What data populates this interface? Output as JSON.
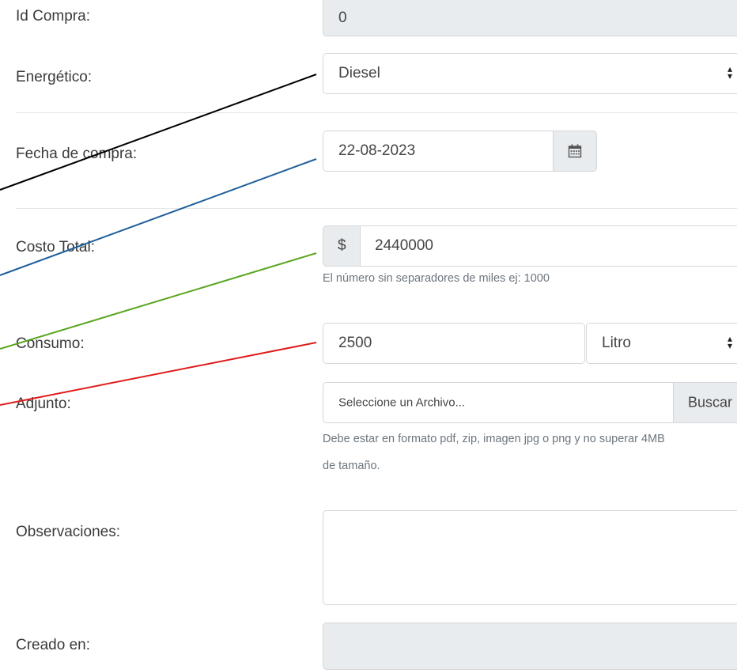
{
  "form": {
    "id_compra": {
      "label": "Id Compra:",
      "value": "0"
    },
    "energetico": {
      "label": "Energético:",
      "value": "Diesel"
    },
    "fecha": {
      "label": "Fecha de compra:",
      "value": "22-08-2023",
      "icon": "calendar-icon"
    },
    "costo": {
      "label": "Costo Total:",
      "prefix": "$",
      "value": "2440000",
      "help": "El número sin separadores de miles ej: 1000"
    },
    "consumo": {
      "label": "Consumo:",
      "value": "2500",
      "unit": "Litro"
    },
    "adjunto": {
      "label": "Adjunto:",
      "placeholder": "Seleccione un Archivo...",
      "button": "Buscar",
      "help_line1": "Debe estar en formato pdf, zip, imagen jpg o png y no superar 4MB",
      "help_line2": "de tamaño."
    },
    "observaciones": {
      "label": "Observaciones:",
      "value": ""
    },
    "creado_en": {
      "label": "Creado en:",
      "value": ""
    }
  },
  "annotation_lines": [
    {
      "target": "energetico",
      "color": "#000000"
    },
    {
      "target": "fecha",
      "color": "#1f5f9a"
    },
    {
      "target": "costo",
      "color": "#5aa51f"
    },
    {
      "target": "consumo",
      "color": "#e01b1b"
    }
  ]
}
